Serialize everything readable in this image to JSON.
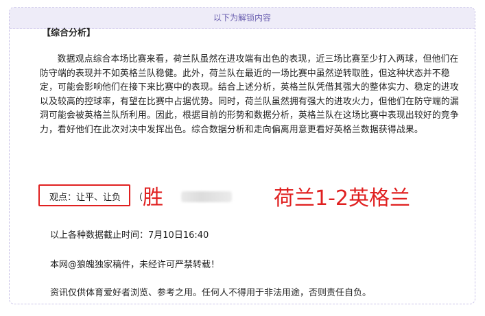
{
  "unlock_header": "以下为解锁内容",
  "section_title": "【综合分析】",
  "analysis_paragraph": "数据观点综合本场比赛来看，荷兰队虽然在进攻端有出色的表现，近三场比赛至少打入两球，但他们在防守端的表现并不如英格兰队稳健。此外，荷兰队在最近的一场比赛中虽然逆转取胜，但这种状态并不稳定，可能会影响他们在接下来比赛中的表现。结合上述分析，英格兰队凭借其强大的整体实力、稳定的进攻以及较高的控球率，有望在比赛中占据优势。同时，荷兰队虽然拥有强大的进攻火力，但他们在防守端的漏洞可能会被英格兰队所利用。因此，根据目前的形势和数据分析，英格兰队在这场比赛中表现出较好的竞争力，看好他们在此次对决中发挥出色。综合数据分析和走向偏离用意更看好英格兰数据获得战果。",
  "viewpoint_label": "观点：让平、让负",
  "viewpoint_paren": "（",
  "annotation_win": "胜",
  "annotation_score": "荷兰1-2英格兰",
  "deadline_text": "以上各种数据截止时间：7月10日16:40",
  "copyright_text": "本网@狼魄独家稿件，未经许可严禁转载！",
  "disclaimer_text": "资讯仅供体育爱好者浏览、参考之用。任何人不得用于非法用途，否则责任自负。",
  "colors": {
    "header_bg": "#eeecf8",
    "header_text": "#6a5fb0",
    "annotation_red": "#e02020",
    "border": "#c9c2e8"
  }
}
